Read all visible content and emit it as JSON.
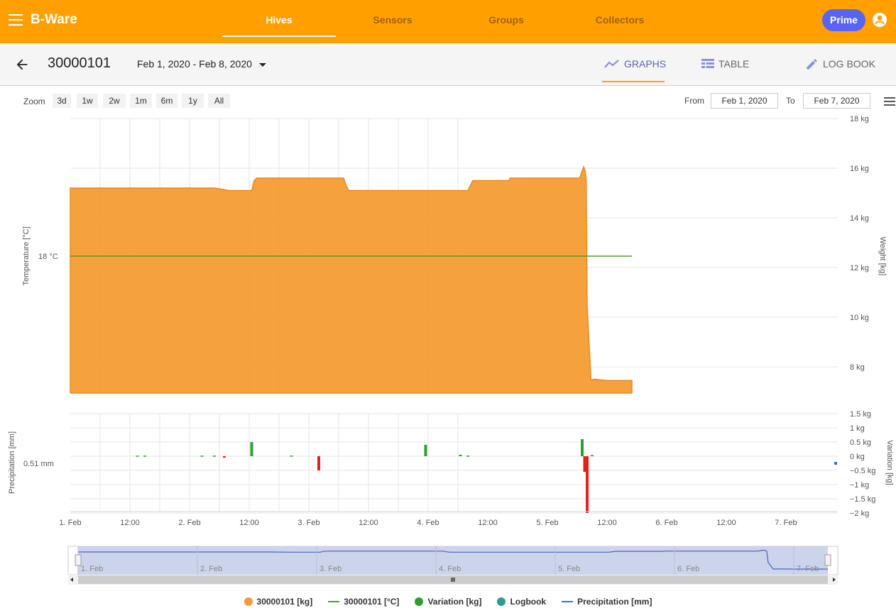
{
  "app": {
    "brand": "B-Ware",
    "prime_label": "Prime"
  },
  "nav": {
    "tabs": [
      {
        "label": "Hives"
      },
      {
        "label": "Sensors"
      },
      {
        "label": "Groups"
      },
      {
        "label": "Collectors"
      }
    ]
  },
  "hive": {
    "id": "30000101",
    "date_range": "Feb 1, 2020 - Feb 8, 2020"
  },
  "views": {
    "graphs": "GRAPHS",
    "table": "TABLE",
    "logbook": "LOG BOOK"
  },
  "zoom": {
    "label": "Zoom",
    "options": [
      "3d",
      "1w",
      "2w",
      "1m",
      "6m",
      "1y",
      "All"
    ]
  },
  "range": {
    "from_label": "From",
    "from_value": "Feb 1, 2020",
    "to_label": "To",
    "to_value": "Feb 7, 2020"
  },
  "colors": {
    "accent": "#ffa000",
    "weight": "#f39c34",
    "temperature": "#5a9a2a",
    "var_pos": "#2ca02c",
    "var_neg": "#e2231a",
    "logbook": "#2a9d8f",
    "precip": "#3a6fd8",
    "prime": "#5865f2"
  },
  "chart_data": {
    "type": "area",
    "x_start": "2020-02-01T00:00",
    "x_ticks": [
      "1. Feb",
      "12:00",
      "2. Feb",
      "12:00",
      "3. Feb",
      "12:00",
      "4. Feb",
      "12:00",
      "5. Feb",
      "12:00",
      "6. Feb",
      "12:00",
      "7. Feb"
    ],
    "main": {
      "ylabel_left": "Temperature [°C]",
      "ylabel_right": "Weight [kg]",
      "y_right_ticks": [
        "18 kg",
        "16 kg",
        "14 kg",
        "12 kg",
        "10 kg",
        "8 kg"
      ],
      "y_right_range": [
        7,
        18
      ],
      "temp_label": "18 °C",
      "weight_hours": [
        0,
        48,
        55,
        58,
        64,
        68,
        73,
        74,
        75,
        76,
        110,
        111,
        112,
        160,
        161,
        162,
        176,
        176.5,
        177,
        178,
        179,
        182,
        196,
        200,
        205,
        206,
        206.6,
        207.2,
        207.6,
        208,
        209.5,
        210,
        210.5,
        211,
        216,
        226
      ],
      "weight_kg": [
        15.2,
        15.2,
        15.2,
        15.2,
        15.1,
        15.1,
        15.1,
        15.5,
        15.6,
        15.6,
        15.6,
        15.3,
        15.1,
        15.1,
        15.3,
        15.5,
        15.5,
        15.5,
        15.6,
        15.6,
        15.6,
        15.6,
        15.6,
        15.6,
        15.6,
        15.9,
        16.05,
        15.9,
        15.5,
        10.5,
        7.5,
        7.45,
        7.5,
        7.5,
        7.45,
        7.45
      ],
      "temperature_c": 18,
      "temperature_hours": [
        0,
        226
      ]
    },
    "variation": {
      "ylabel_left": "Precipitation [mm]",
      "ylabel_right": "Variation [kg]",
      "y_right_ticks": [
        "1.5 kg",
        "1 kg",
        "0.5 kg",
        "0 kg",
        "−0.5 kg",
        "−1 kg",
        "−1.5 kg",
        "−2 kg"
      ],
      "y_right_range": [
        -2,
        1.5
      ],
      "precip_label": "0.51 mm",
      "bars_hours": [
        27,
        30,
        53,
        58,
        62,
        73,
        89,
        100,
        143,
        157,
        160,
        206,
        207,
        208,
        210
      ],
      "bars_kg": [
        0.02,
        0.02,
        0.02,
        0.02,
        -0.05,
        0.5,
        0.02,
        -0.5,
        0.4,
        0.05,
        0.02,
        0.6,
        -0.55,
        -2.0,
        0.04
      ],
      "precip_hours": [
        230
      ],
      "precip_mm": [
        0.51
      ]
    },
    "navigator": {
      "labels": [
        "1. Feb",
        "2. Feb",
        "3. Feb",
        "4. Feb",
        "5. Feb",
        "6. Feb",
        "7. Feb"
      ]
    },
    "legend": [
      {
        "name": "30000101 [kg]",
        "kind": "dot",
        "color": "#f39c34"
      },
      {
        "name": "30000101 [°C]",
        "kind": "line",
        "color": "#5a9a2a"
      },
      {
        "name": "Variation [kg]",
        "kind": "dot",
        "color": "#2ca02c"
      },
      {
        "name": "Logbook",
        "kind": "dot",
        "color": "#2a9d8f"
      },
      {
        "name": "Precipitation [mm]",
        "kind": "linedot",
        "color": "#3a6fd8"
      }
    ]
  }
}
